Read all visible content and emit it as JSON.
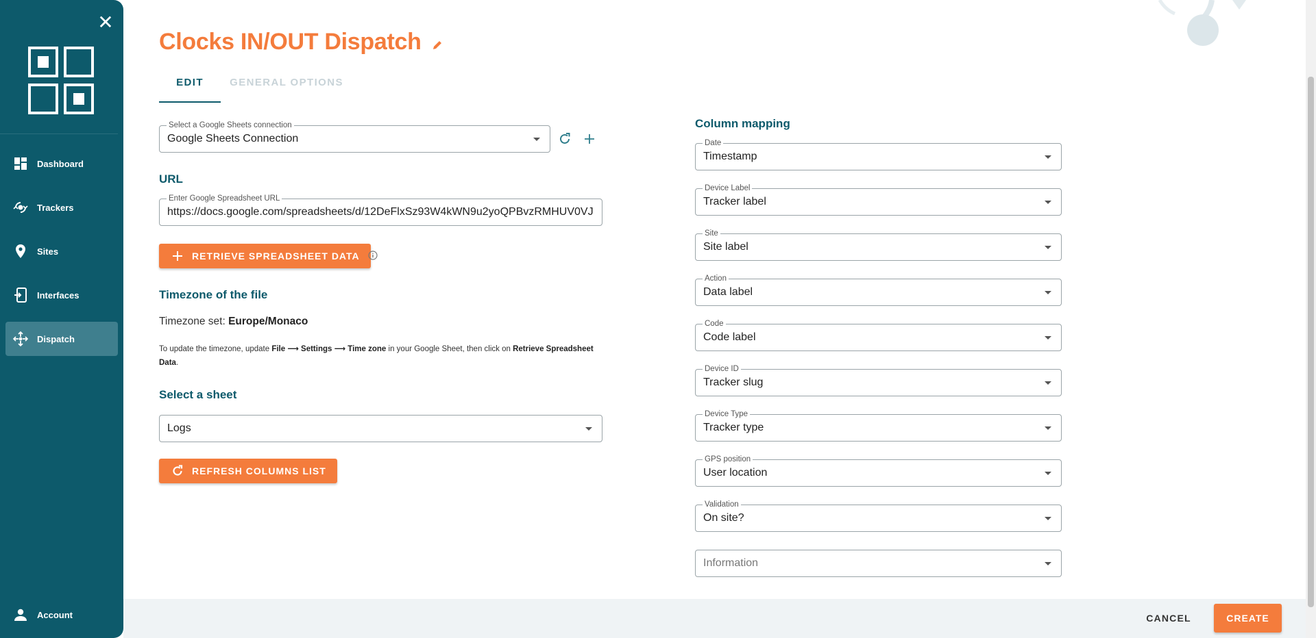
{
  "sidebar": {
    "close_label": "✕",
    "items": [
      {
        "label": "Dashboard"
      },
      {
        "label": "Trackers"
      },
      {
        "label": "Sites"
      },
      {
        "label": "Interfaces"
      },
      {
        "label": "Dispatch"
      }
    ],
    "account_label": "Account",
    "active_item": "Dispatch"
  },
  "header": {
    "title": "Clocks IN/OUT Dispatch"
  },
  "tabs": [
    {
      "label": "EDIT"
    },
    {
      "label": "GENERAL OPTIONS"
    }
  ],
  "left": {
    "connection": {
      "label": "Select a Google Sheets connection",
      "value": "Google Sheets Connection"
    },
    "url_heading": "URL",
    "url_field": {
      "label": "Enter Google Spreadsheet URL",
      "value": "https://docs.google.com/spreadsheets/d/12DeFlxSz93W4kWN9u2yoQPBvzRMHUV0VJ"
    },
    "retrieve_button": "RETRIEVE SPREADSHEET DATA",
    "timezone_heading": "Timezone of the file",
    "timezone_set_label": "Timezone set: ",
    "timezone_value": "Europe/Monaco",
    "timezone_help": {
      "part1": "To update the timezone, update ",
      "file": "File",
      "arrow1": " ⟶ ",
      "settings": "Settings",
      "arrow2": " ⟶ ",
      "timezone": "Time zone",
      "part2": " in your Google Sheet, then click on ",
      "retrieve": "Retrieve Spreadsheet Data",
      "part3": "."
    },
    "sheet_heading": "Select a sheet",
    "sheet_value": "Logs",
    "refresh_button": "REFRESH COLUMNS LIST"
  },
  "mapping": {
    "heading": "Column mapping",
    "fields": [
      {
        "label": "Date",
        "value": "Timestamp"
      },
      {
        "label": "Device Label",
        "value": "Tracker label"
      },
      {
        "label": "Site",
        "value": "Site label"
      },
      {
        "label": "Action",
        "value": "Data label"
      },
      {
        "label": "Code",
        "value": "Code label"
      },
      {
        "label": "Device ID",
        "value": "Tracker slug"
      },
      {
        "label": "Device Type",
        "value": "Tracker type"
      },
      {
        "label": "GPS position",
        "value": "User location"
      },
      {
        "label": "Validation",
        "value": "On site?"
      }
    ],
    "information_placeholder": "Information"
  },
  "footer": {
    "cancel": "CANCEL",
    "create": "CREATE"
  },
  "colors": {
    "sidebar": "#0d5a6b",
    "accent": "#f47c3c",
    "active_nav": "#3f7f8e",
    "footer_bg": "#eff3f5"
  }
}
